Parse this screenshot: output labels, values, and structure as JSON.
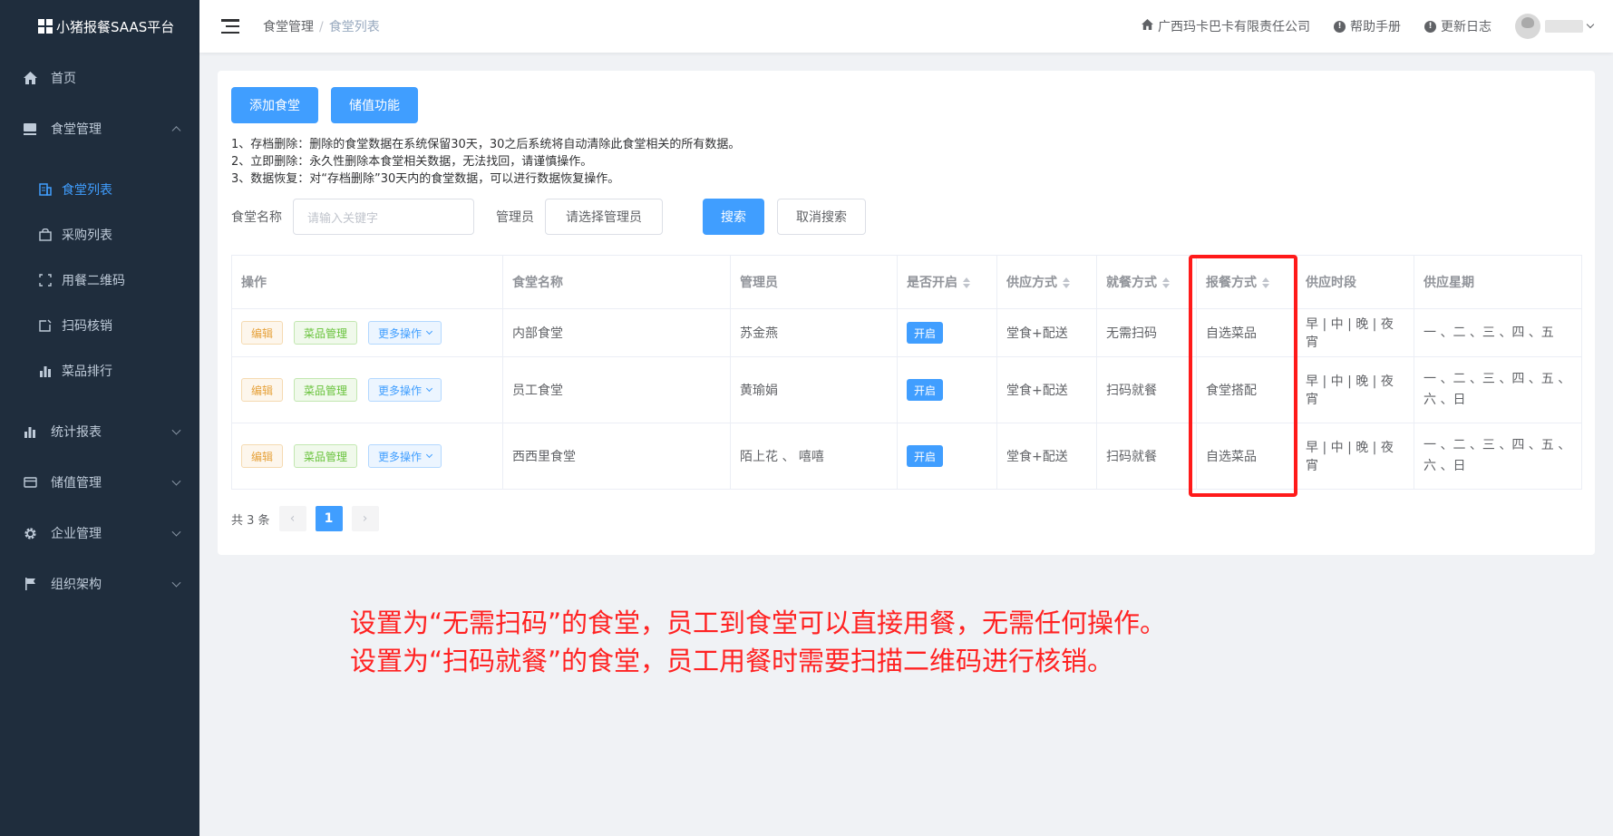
{
  "sidebar": {
    "logo_text": "小猪报餐SAAS平台",
    "items": [
      {
        "label": "首页",
        "icon": "home-icon"
      },
      {
        "label": "食堂管理",
        "icon": "canteen-icon"
      },
      {
        "label": "食堂列表",
        "icon": "list-icon"
      },
      {
        "label": "采购列表",
        "icon": "bag-icon"
      },
      {
        "label": "用餐二维码",
        "icon": "scan-frame-icon"
      },
      {
        "label": "扫码核销",
        "icon": "edit-box-icon"
      },
      {
        "label": "菜品排行",
        "icon": "bar-chart-icon"
      },
      {
        "label": "统计报表",
        "icon": "bar-chart-icon"
      },
      {
        "label": "储值管理",
        "icon": "card-icon"
      },
      {
        "label": "企业管理",
        "icon": "gear-icon"
      },
      {
        "label": "组织架构",
        "icon": "flag-icon"
      }
    ]
  },
  "header": {
    "breadcrumb": [
      "食堂管理",
      "食堂列表"
    ],
    "company": "广西玛卡巴卡有限责任公司",
    "help": "帮助手册",
    "changelog": "更新日志"
  },
  "toolbar": {
    "add_label": "添加食堂",
    "recharge_label": "储值功能"
  },
  "notes": [
    "1、存档删除：删除的食堂数据在系统保留30天，30之后系统将自动清除此食堂相关的所有数据。",
    "2、立即删除：永久性删除本食堂相关数据，无法找回，请谨慎操作。",
    "3、数据恢复：对“存档删除”30天内的食堂数据，可以进行数据恢复操作。"
  ],
  "search": {
    "name_label": "食堂名称",
    "name_placeholder": "请输入关键字",
    "admin_label": "管理员",
    "admin_select": "请选择管理员",
    "search_label": "搜索",
    "cancel_label": "取消搜索"
  },
  "table": {
    "headers": [
      "操作",
      "食堂名称",
      "管理员",
      "是否开启",
      "供应方式",
      "就餐方式",
      "报餐方式",
      "供应时段",
      "供应星期"
    ],
    "action_labels": {
      "edit": "编辑",
      "menu": "菜品管理",
      "more": "更多操作"
    },
    "rows": [
      {
        "name": "内部食堂",
        "admin": "苏金燕",
        "status": "开启",
        "supply": "堂食+配送",
        "dine": "无需扫码",
        "order": "自选菜品",
        "period": "早 | 中 | 晚 | 夜宵",
        "week": "一 、二 、三 、四 、五"
      },
      {
        "name": "员工食堂",
        "admin": "黄瑜娟",
        "status": "开启",
        "supply": "堂食+配送",
        "dine": "扫码就餐",
        "order": "食堂搭配",
        "period": "早 | 中 | 晚 | 夜宵",
        "week": "一 、二 、三 、四 、五 、六 、日"
      },
      {
        "name": "西西里食堂",
        "admin": "陌上花 、 嘻嘻",
        "status": "开启",
        "supply": "堂食+配送",
        "dine": "扫码就餐",
        "order": "自选菜品",
        "period": "早 | 中 | 晚 | 夜宵",
        "week": "一 、二 、三 、四 、五 、六 、日"
      }
    ]
  },
  "pagination": {
    "total": "共 3 条",
    "current": "1",
    "prev": "‹",
    "next": "›"
  },
  "annotation": [
    "设置为“无需扫码”的食堂，员工到食堂可以直接用餐，无需任何操作。",
    "设置为“扫码就餐”的食堂，员工用餐时需要扫描二维码进行核销。"
  ],
  "colors": {
    "primary": "#409eff",
    "sidebar_bg": "#1f2d3d",
    "highlight": "#ff1a1a"
  }
}
